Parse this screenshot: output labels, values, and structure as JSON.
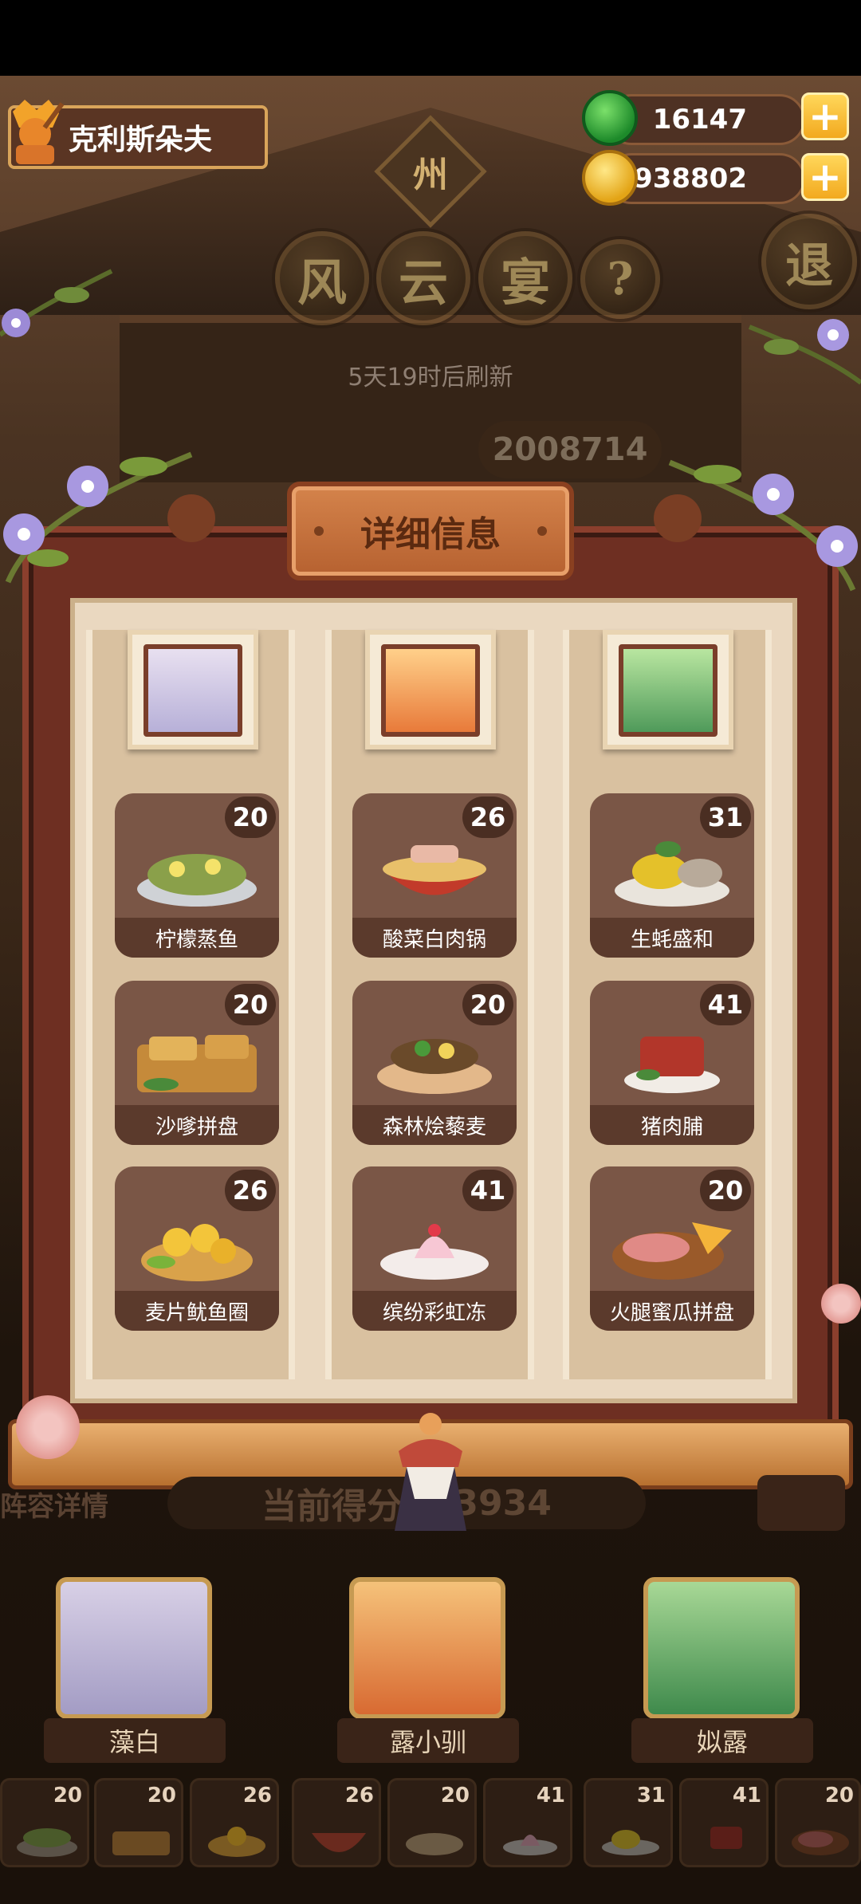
{
  "player": {
    "name": "克利斯朵夫"
  },
  "currencies": [
    {
      "icon": "jade-coin-icon",
      "value": "16147"
    },
    {
      "icon": "gold-coin-icon",
      "value": "7938802"
    }
  ],
  "banner": {
    "region": "州",
    "title_chars": [
      "风",
      "云",
      "宴"
    ],
    "help": "?",
    "exit": "退",
    "refresh": "5天19时后刷新",
    "score_peek": "2008714"
  },
  "modal": {
    "title": "详细信息",
    "columns": [
      {
        "dishes": [
          {
            "name": "柠檬蒸鱼",
            "count": "20"
          },
          {
            "name": "沙嗲拼盘",
            "count": "20"
          },
          {
            "name": "麦片鱿鱼圈",
            "count": "26"
          }
        ]
      },
      {
        "dishes": [
          {
            "name": "酸菜白肉锅",
            "count": "26"
          },
          {
            "name": "森林烩藜麦",
            "count": "20"
          },
          {
            "name": "缤纷彩虹冻",
            "count": "41"
          }
        ]
      },
      {
        "dishes": [
          {
            "name": "生蚝盛和",
            "count": "31"
          },
          {
            "name": "猪肉脯",
            "count": "41"
          },
          {
            "name": "火腿蜜瓜拼盘",
            "count": "20"
          }
        ]
      }
    ]
  },
  "behind": {
    "left_label": "阵容详情",
    "score_text": "当前得分",
    "score_tail": "943934"
  },
  "roster": [
    {
      "name": "藻白"
    },
    {
      "name": "露小驯"
    },
    {
      "name": "姒露"
    }
  ],
  "slots": [
    "20",
    "20",
    "26",
    "26",
    "20",
    "41",
    "31",
    "41",
    "20"
  ],
  "colors": {
    "accent": "#d9a45a",
    "frame": "#6e2f22",
    "panel": "#ead8c0",
    "badge": "#4a2e22"
  }
}
